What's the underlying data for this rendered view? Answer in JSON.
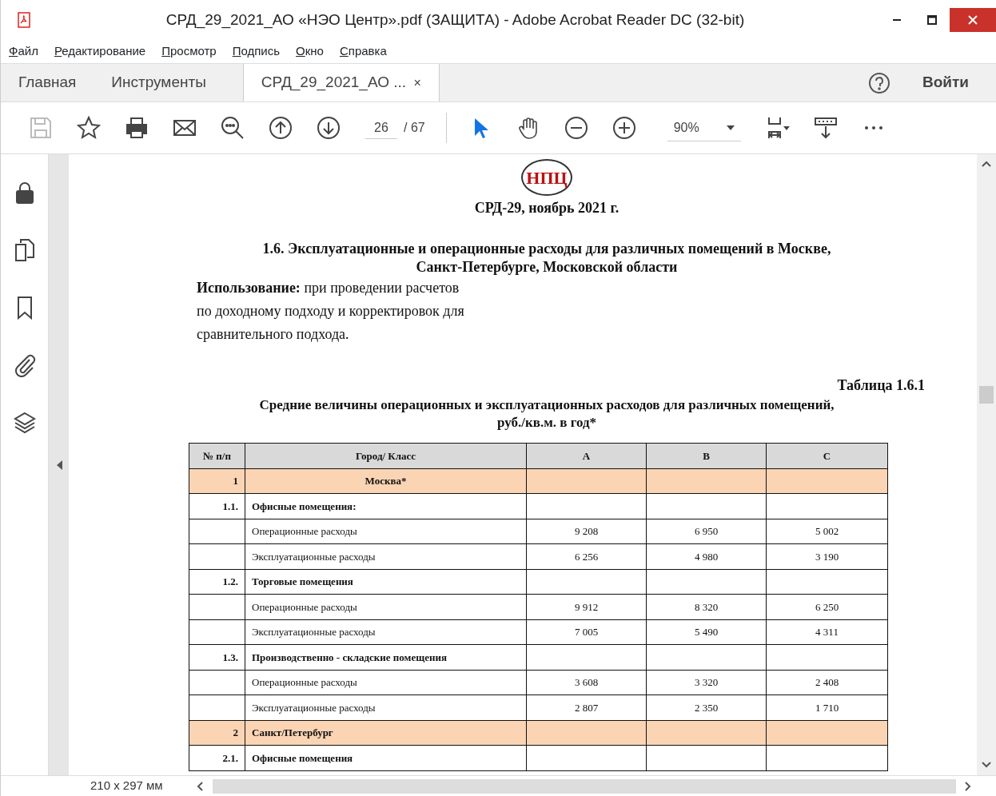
{
  "window": {
    "title": "СРД_29_2021_АО «НЭО Центр».pdf (ЗАЩИТА) - Adobe Acrobat Reader DC (32-bit)"
  },
  "menu": [
    "Файл",
    "Редактирование",
    "Просмотр",
    "Подпись",
    "Окно",
    "Справка"
  ],
  "tabs": [
    {
      "label": "Главная",
      "selected": false
    },
    {
      "label": "Инструменты",
      "selected": false
    },
    {
      "label": "СРД_29_2021_АО ...",
      "selected": true,
      "close": "×"
    }
  ],
  "sign_in": "Войти",
  "toolbar": {
    "save_disabled": true,
    "page": "26",
    "page_count": "/ 67",
    "pointer_selected": true,
    "zoom": "90%"
  },
  "document": {
    "logo": "НПЦ",
    "edition": "СРД-29, ноябрь 2021 г.",
    "heading": [
      "1.6. Эксплуатационные и операционные расходы для различных помещений в Москве,",
      "Санкт-Петербурге, Московской области"
    ],
    "usage": [
      "**Использование:** при проведении расчетов",
      "по доходному подходу и корректировок для",
      "сравнительного подхода."
    ],
    "table_number": "Таблица 1.6.1",
    "table_caption": [
      "Средние величины операционных и эксплуатационных расходов для различных помещений,",
      "руб./кв.м. в год*"
    ],
    "table": {
      "columns": [
        "№ п/п",
        "Город/ Класс",
        "A",
        "B",
        "C"
      ],
      "rows": [
        {
          "kind": "section",
          "cells": [
            "1",
            "Москва*",
            "",
            "",
            ""
          ]
        },
        {
          "kind": "group",
          "cells": [
            "1.1.",
            "Офисные помещения:",
            "",
            "",
            ""
          ]
        },
        {
          "kind": "item",
          "cells": [
            "",
            "Операционные расходы",
            "9 208",
            "6 950",
            "5 002"
          ]
        },
        {
          "kind": "item",
          "cells": [
            "",
            "Эксплуатационные расходы",
            "6 256",
            "4 980",
            "3 190"
          ]
        },
        {
          "kind": "group",
          "cells": [
            "1.2.",
            "Торговые помещения",
            "",
            "",
            ""
          ]
        },
        {
          "kind": "item",
          "cells": [
            "",
            "Операционные расходы",
            "9 912",
            "8 320",
            "6 250"
          ]
        },
        {
          "kind": "item",
          "cells": [
            "",
            "Эксплуатационные расходы",
            "7 005",
            "5 490",
            "4 311"
          ]
        },
        {
          "kind": "group",
          "cells": [
            "1.3.",
            "Производственно - складские помещения",
            "",
            "",
            ""
          ]
        },
        {
          "kind": "item",
          "cells": [
            "",
            "Операционные расходы",
            "3 608",
            "3 320",
            "2 408"
          ]
        },
        {
          "kind": "item",
          "cells": [
            "",
            "Эксплуатационные расходы",
            "2 807",
            "2 350",
            "1 710"
          ]
        },
        {
          "kind": "section_left",
          "cells": [
            "2",
            "Санкт/Петербург",
            "",
            "",
            ""
          ]
        },
        {
          "kind": "group",
          "cells": [
            "2.1.",
            "Офисные помещения",
            "",
            "",
            ""
          ]
        }
      ]
    }
  },
  "status": {
    "page_size": "210 x 297 мм"
  }
}
